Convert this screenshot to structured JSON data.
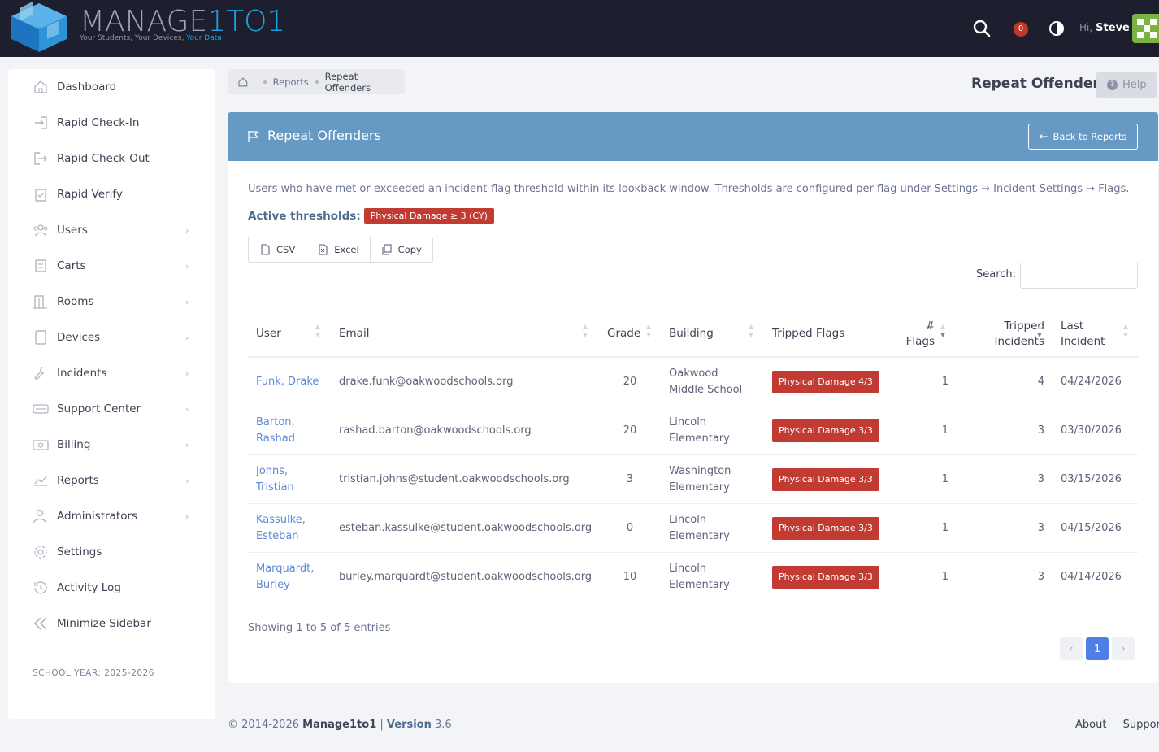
{
  "brand": {
    "name_part1": "MANAGE",
    "name_part2": "1TO1",
    "tagline_part1": "Your Students, Your Devices, ",
    "tagline_part2": "Your Data",
    "accent_color": "#1da1e2"
  },
  "topbar": {
    "notification_count": "0",
    "greeting": "Hi,",
    "user_name": "Steve"
  },
  "sidebar": {
    "items": [
      {
        "label": "Dashboard",
        "icon": "home-icon",
        "has_children": false
      },
      {
        "label": "Rapid Check-In",
        "icon": "sign-in-icon",
        "has_children": false
      },
      {
        "label": "Rapid Check-Out",
        "icon": "sign-out-icon",
        "has_children": false
      },
      {
        "label": "Rapid Verify",
        "icon": "clipboard-check-icon",
        "has_children": false
      },
      {
        "label": "Users",
        "icon": "users-icon",
        "has_children": true
      },
      {
        "label": "Carts",
        "icon": "cart-icon",
        "has_children": true
      },
      {
        "label": "Rooms",
        "icon": "door-icon",
        "has_children": true
      },
      {
        "label": "Devices",
        "icon": "tablet-icon",
        "has_children": true
      },
      {
        "label": "Incidents",
        "icon": "wrench-icon",
        "has_children": true
      },
      {
        "label": "Support Center",
        "icon": "support-icon",
        "has_children": true
      },
      {
        "label": "Billing",
        "icon": "money-icon",
        "has_children": true
      },
      {
        "label": "Reports",
        "icon": "chart-icon",
        "has_children": true
      },
      {
        "label": "Administrators",
        "icon": "admin-icon",
        "has_children": true
      },
      {
        "label": "Settings",
        "icon": "gear-icon",
        "has_children": false
      },
      {
        "label": "Activity Log",
        "icon": "history-icon",
        "has_children": false
      },
      {
        "label": "Minimize Sidebar",
        "icon": "double-chevron-left-icon",
        "has_children": false
      }
    ],
    "school_year": "SCHOOL YEAR: 2025-2026"
  },
  "breadcrumb": {
    "items": [
      "Reports",
      "Repeat Offenders"
    ]
  },
  "page": {
    "title": "Repeat Offenders",
    "help_label": "Help"
  },
  "card": {
    "title": "Repeat Offenders",
    "back_label": "Back to Reports",
    "description": "Users who have met or exceeded an incident-flag threshold within its lookback window. Thresholds are configured per flag under Settings → Incident Settings → Flags.",
    "thresholds_label": "Active thresholds:",
    "threshold_badge": "Physical Damage ≥ 3 (CY)",
    "header_color": "#6699c4",
    "badge_color": "#c23b33"
  },
  "export_buttons": [
    "CSV",
    "Excel",
    "Copy"
  ],
  "search": {
    "label": "Search:",
    "value": ""
  },
  "table": {
    "columns": [
      "User",
      "Email",
      "Grade",
      "Building",
      "Tripped Flags",
      "# Flags",
      "Tripped Incidents",
      "Last Incident"
    ],
    "rows": [
      {
        "user": "Funk, Drake",
        "email": "drake.funk@oakwoodschools.org",
        "grade": "20",
        "building": "Oakwood Middle School",
        "flags": "Physical Damage 4/3",
        "num_flags": "1",
        "incidents": "4",
        "last": "04/24/2026"
      },
      {
        "user": "Barton, Rashad",
        "email": "rashad.barton@oakwoodschools.org",
        "grade": "20",
        "building": "Lincoln Elementary",
        "flags": "Physical Damage 3/3",
        "num_flags": "1",
        "incidents": "3",
        "last": "03/30/2026"
      },
      {
        "user": "Johns, Tristian",
        "email": "tristian.johns@student.oakwoodschools.org",
        "grade": "3",
        "building": "Washington Elementary",
        "flags": "Physical Damage 3/3",
        "num_flags": "1",
        "incidents": "3",
        "last": "03/15/2026"
      },
      {
        "user": "Kassulke, Esteban",
        "email": "esteban.kassulke@student.oakwoodschools.org",
        "grade": "0",
        "building": "Lincoln Elementary",
        "flags": "Physical Damage 3/3",
        "num_flags": "1",
        "incidents": "3",
        "last": "04/15/2026"
      },
      {
        "user": "Marquardt, Burley",
        "email": "burley.marquardt@student.oakwoodschools.org",
        "grade": "10",
        "building": "Lincoln Elementary",
        "flags": "Physical Damage 3/3",
        "num_flags": "1",
        "incidents": "3",
        "last": "04/14/2026"
      }
    ]
  },
  "pagination": {
    "info": "Showing 1 to 5 of 5 entries",
    "prev": "‹",
    "current": "1",
    "next": "›"
  },
  "footer": {
    "copyright": "© 2014-2026",
    "brand": "Manage1to1",
    "version_label": "Version",
    "version": "3.6",
    "links": [
      "About",
      "Support"
    ]
  }
}
